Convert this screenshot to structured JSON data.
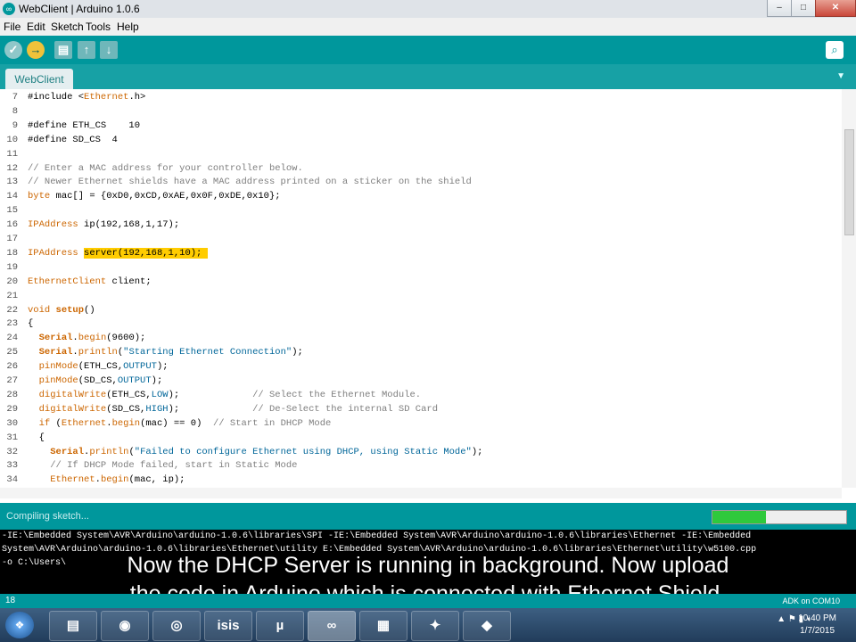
{
  "window": {
    "title": "WebClient | Arduino 1.0.6",
    "app_icon": "arduino-icon",
    "buttons": [
      "–",
      "□",
      "✕"
    ]
  },
  "menu": {
    "items": [
      "File",
      "Edit",
      "Sketch",
      "Tools",
      "Help"
    ]
  },
  "toolbar": {
    "verify": "✓",
    "upload": "→",
    "new": "▤",
    "open": "↑",
    "save": "↓",
    "serial_monitor": "⌕"
  },
  "tab": {
    "label": "WebClient"
  },
  "code": [
    {
      "n": "7",
      "s": [
        {
          "t": "#include <"
        },
        {
          "t": "Ethernet",
          "c": "kw"
        },
        {
          "t": ".h>"
        }
      ]
    },
    {
      "n": "8",
      "s": []
    },
    {
      "n": "9",
      "s": [
        {
          "t": "#define ETH_CS    10"
        }
      ]
    },
    {
      "n": "10",
      "s": [
        {
          "t": "#define SD_CS  4"
        }
      ]
    },
    {
      "n": "11",
      "s": []
    },
    {
      "n": "12",
      "s": [
        {
          "t": "// Enter a MAC address for your controller below.",
          "c": "cm"
        }
      ]
    },
    {
      "n": "13",
      "s": [
        {
          "t": "// Newer Ethernet shields have a MAC address printed on a sticker on the shield",
          "c": "cm"
        }
      ]
    },
    {
      "n": "14",
      "s": [
        {
          "t": "byte",
          "c": "kw"
        },
        {
          "t": " mac[] = {0xD0,0xCD,0xAE,0x0F,0xDE,0x10};"
        }
      ]
    },
    {
      "n": "15",
      "s": []
    },
    {
      "n": "16",
      "s": [
        {
          "t": "IPAddress",
          "c": "kw"
        },
        {
          "t": " ip(192,168,1,17);"
        }
      ]
    },
    {
      "n": "17",
      "s": []
    },
    {
      "n": "18",
      "s": [
        {
          "t": "IPAddress",
          "c": "kw"
        },
        {
          "t": " "
        },
        {
          "t": "server(192,168,1,10); ",
          "c": "hl"
        }
      ]
    },
    {
      "n": "19",
      "s": []
    },
    {
      "n": "20",
      "s": [
        {
          "t": "EthernetClient",
          "c": "kw"
        },
        {
          "t": " client;"
        }
      ]
    },
    {
      "n": "21",
      "s": []
    },
    {
      "n": "22",
      "s": [
        {
          "t": "void",
          "c": "kw"
        },
        {
          "t": " "
        },
        {
          "t": "setup",
          "c": "fn"
        },
        {
          "t": "()"
        }
      ]
    },
    {
      "n": "23",
      "s": [
        {
          "t": "{"
        }
      ]
    },
    {
      "n": "24",
      "s": [
        {
          "t": "  "
        },
        {
          "t": "Serial",
          "c": "fn"
        },
        {
          "t": "."
        },
        {
          "t": "begin",
          "c": "kw"
        },
        {
          "t": "(9600);"
        }
      ]
    },
    {
      "n": "25",
      "s": [
        {
          "t": "  "
        },
        {
          "t": "Serial",
          "c": "fn"
        },
        {
          "t": "."
        },
        {
          "t": "println",
          "c": "kw"
        },
        {
          "t": "("
        },
        {
          "t": "\"Starting Ethernet Connection\"",
          "c": "str"
        },
        {
          "t": ");"
        }
      ]
    },
    {
      "n": "26",
      "s": [
        {
          "t": "  "
        },
        {
          "t": "pinMode",
          "c": "kw"
        },
        {
          "t": "(ETH_CS,"
        },
        {
          "t": "OUTPUT",
          "c": "str"
        },
        {
          "t": ");"
        }
      ]
    },
    {
      "n": "27",
      "s": [
        {
          "t": "  "
        },
        {
          "t": "pinMode",
          "c": "kw"
        },
        {
          "t": "(SD_CS,"
        },
        {
          "t": "OUTPUT",
          "c": "str"
        },
        {
          "t": ");"
        }
      ]
    },
    {
      "n": "28",
      "s": [
        {
          "t": "  "
        },
        {
          "t": "digitalWrite",
          "c": "kw"
        },
        {
          "t": "(ETH_CS,"
        },
        {
          "t": "LOW",
          "c": "str"
        },
        {
          "t": ");             "
        },
        {
          "t": "// Select the Ethernet Module.",
          "c": "cm"
        }
      ]
    },
    {
      "n": "29",
      "s": [
        {
          "t": "  "
        },
        {
          "t": "digitalWrite",
          "c": "kw"
        },
        {
          "t": "(SD_CS,"
        },
        {
          "t": "HIGH",
          "c": "str"
        },
        {
          "t": ");             "
        },
        {
          "t": "// De-Select the internal SD Card",
          "c": "cm"
        }
      ]
    },
    {
      "n": "30",
      "s": [
        {
          "t": "  "
        },
        {
          "t": "if",
          "c": "kw"
        },
        {
          "t": " ("
        },
        {
          "t": "Ethernet",
          "c": "kw"
        },
        {
          "t": "."
        },
        {
          "t": "begin",
          "c": "kw"
        },
        {
          "t": "(mac) == 0)  "
        },
        {
          "t": "// Start in DHCP Mode",
          "c": "cm"
        }
      ]
    },
    {
      "n": "31",
      "s": [
        {
          "t": "  {"
        }
      ]
    },
    {
      "n": "32",
      "s": [
        {
          "t": "    "
        },
        {
          "t": "Serial",
          "c": "fn"
        },
        {
          "t": "."
        },
        {
          "t": "println",
          "c": "kw"
        },
        {
          "t": "("
        },
        {
          "t": "\"Failed to configure Ethernet using DHCP, using Static Mode\"",
          "c": "str"
        },
        {
          "t": ");"
        }
      ]
    },
    {
      "n": "33",
      "s": [
        {
          "t": "    "
        },
        {
          "t": "// If DHCP Mode failed, start in Static Mode",
          "c": "cm"
        }
      ]
    },
    {
      "n": "34",
      "s": [
        {
          "t": "    "
        },
        {
          "t": "Ethernet",
          "c": "kw"
        },
        {
          "t": "."
        },
        {
          "t": "begin",
          "c": "kw"
        },
        {
          "t": "(mac, ip);"
        }
      ]
    }
  ],
  "status": {
    "message": "Compiling sketch...",
    "progress": 0.4
  },
  "console": {
    "lines": [
      "-IE:\\Embedded System\\AVR\\Arduino\\arduino-1.0.6\\libraries\\SPI -IE:\\Embedded System\\AVR\\Arduino\\arduino-1.0.6\\libraries\\Ethernet -IE:\\Embedded",
      "System\\AVR\\Arduino\\arduino-1.0.6\\libraries\\Ethernet\\utility E:\\Embedded System\\AVR\\Arduino\\arduino-1.0.6\\libraries\\Ethernet\\utility\\w5100.cpp",
      "-o C:\\Users\\"
    ]
  },
  "caption": {
    "line1": "Now the DHCP Server is running in background. Now upload",
    "line2": "the code in Arduino which is connected with Ethernet Shield."
  },
  "footer": {
    "line_number": "18",
    "board": "ADK on COM10"
  },
  "taskbar": {
    "start_icon": "windows-start-icon",
    "apps": [
      {
        "name": "explorer",
        "label": "▤"
      },
      {
        "name": "firefox",
        "label": "◉"
      },
      {
        "name": "chrome",
        "label": "◎"
      },
      {
        "name": "isis",
        "label": "isis"
      },
      {
        "name": "utorrent",
        "label": "µ"
      },
      {
        "name": "arduino",
        "label": "∞"
      },
      {
        "name": "app-window",
        "label": "▦"
      },
      {
        "name": "tools",
        "label": "✦"
      },
      {
        "name": "app-tool",
        "label": "◆"
      }
    ],
    "time": "10:40 PM",
    "date": "1/7/2015"
  }
}
